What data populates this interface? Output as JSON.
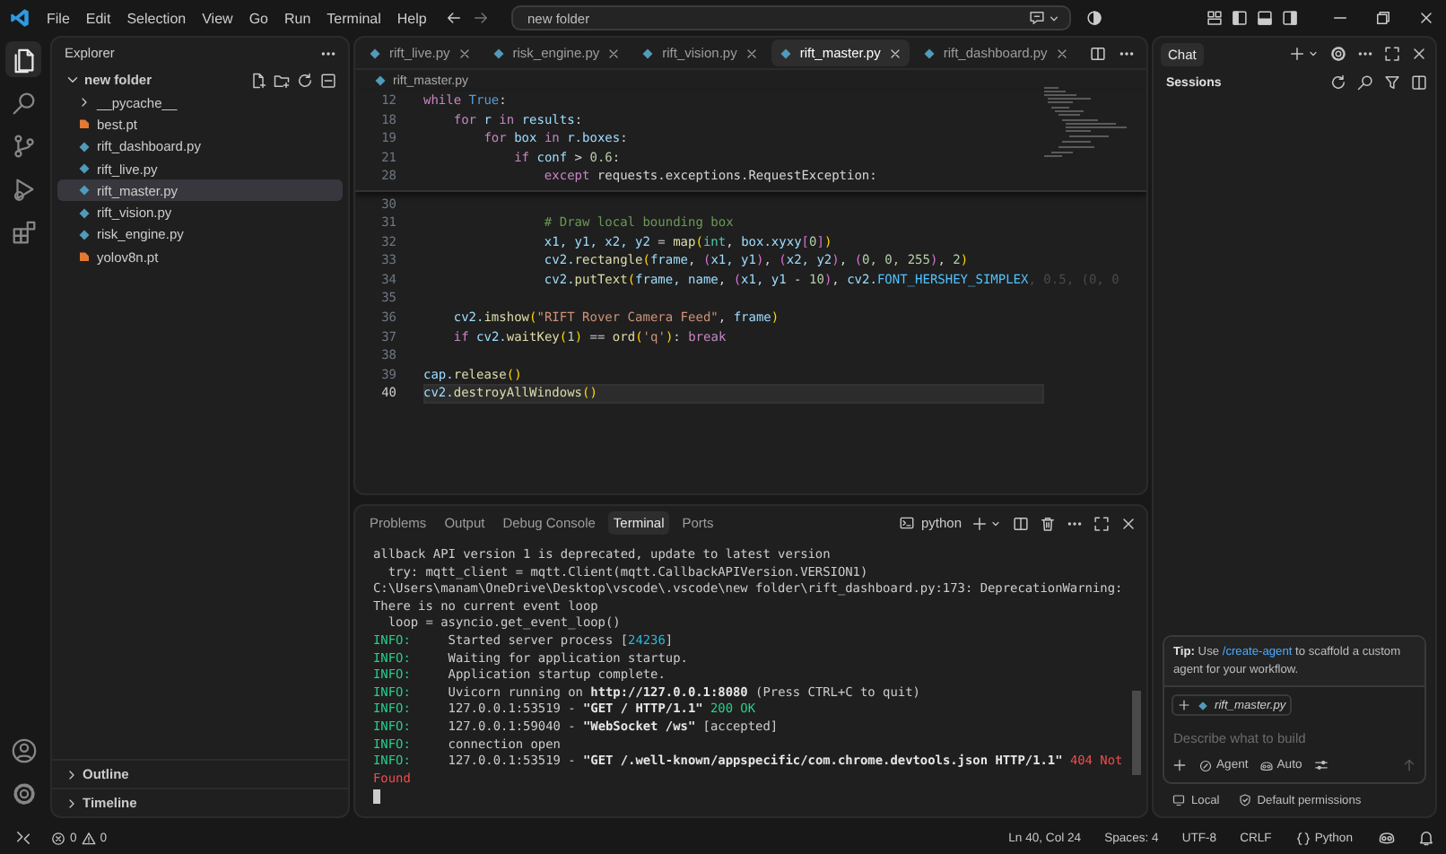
{
  "title_bar": {
    "menus": [
      "File",
      "Edit",
      "Selection",
      "View",
      "Go",
      "Run",
      "Terminal",
      "Help"
    ],
    "search": "new folder"
  },
  "activity_bar": [
    {
      "kind": "files",
      "selected": true
    },
    {
      "kind": "search",
      "selected": false
    },
    {
      "kind": "source-control",
      "selected": false
    },
    {
      "kind": "run",
      "selected": false
    },
    {
      "kind": "extensions",
      "selected": false
    }
  ],
  "explorer": {
    "title": "Explorer",
    "folder": {
      "name": "new folder",
      "expanded": true,
      "children": [
        {
          "name": "__pycache__",
          "kind": "folder",
          "expanded": false,
          "selected": false
        },
        {
          "name": "best.pt",
          "kind": "model",
          "selected": false
        },
        {
          "name": "rift_dashboard.py",
          "kind": "python",
          "selected": false
        },
        {
          "name": "rift_live.py",
          "kind": "python",
          "selected": false
        },
        {
          "name": "rift_master.py",
          "kind": "python",
          "selected": true
        },
        {
          "name": "rift_vision.py",
          "kind": "python",
          "selected": false
        },
        {
          "name": "risk_engine.py",
          "kind": "python",
          "selected": false
        },
        {
          "name": "yolov8n.pt",
          "kind": "model",
          "selected": false
        }
      ]
    },
    "sections": [
      {
        "name": "Outline",
        "expanded": false
      },
      {
        "name": "Timeline",
        "expanded": false
      }
    ]
  },
  "editor": {
    "tabs": [
      {
        "label": "rift_live.py",
        "selected": false
      },
      {
        "label": "risk_engine.py",
        "selected": false
      },
      {
        "label": "rift_vision.py",
        "selected": false
      },
      {
        "label": "rift_master.py",
        "selected": true
      },
      {
        "label": "rift_dashboard.py",
        "selected": false
      }
    ],
    "breadcrumb": "rift_master.py",
    "sticky_lines": [
      {
        "number": "12",
        "tokens": [
          {
            "text": "while",
            "kind": "kw"
          },
          {
            "text": " True",
            "kind": "const"
          },
          {
            "text": ":",
            "kind": "plain"
          }
        ]
      },
      {
        "number": "18",
        "tokens": [
          {
            "text": "    for",
            "kind": "kw"
          },
          {
            "text": " r ",
            "kind": "var"
          },
          {
            "text": "in",
            "kind": "kw"
          },
          {
            "text": " results",
            "kind": "var"
          },
          {
            "text": ":",
            "kind": "plain"
          }
        ]
      },
      {
        "number": "19",
        "tokens": [
          {
            "text": "        for",
            "kind": "kw"
          },
          {
            "text": " box ",
            "kind": "var"
          },
          {
            "text": "in",
            "kind": "kw"
          },
          {
            "text": " r.boxes",
            "kind": "var"
          },
          {
            "text": ":",
            "kind": "plain"
          }
        ]
      },
      {
        "number": "21",
        "tokens": [
          {
            "text": "            if",
            "kind": "kw"
          },
          {
            "text": " conf",
            "kind": "var"
          },
          {
            "text": " > ",
            "kind": "plain"
          },
          {
            "text": "0.6",
            "kind": "num"
          },
          {
            "text": ":",
            "kind": "plain"
          }
        ]
      },
      {
        "number": "28",
        "tokens": [
          {
            "text": "                except",
            "kind": "kw"
          },
          {
            "text": " requests.exceptions.RequestException:",
            "kind": "plain"
          }
        ]
      }
    ],
    "lines": [
      {
        "number": "30",
        "current": false
      },
      {
        "number": "31",
        "current": false,
        "tokens": [
          {
            "text": "                # Draw local bounding box",
            "kind": "com"
          }
        ]
      },
      {
        "number": "32",
        "current": false,
        "tokens": [
          {
            "text": "                x1, y1, x2, y2",
            "kind": "var"
          },
          {
            "text": " = ",
            "kind": "plain"
          },
          {
            "text": "map",
            "kind": "fn"
          },
          {
            "text": "(",
            "kind": "b1"
          },
          {
            "text": "int",
            "kind": "cls"
          },
          {
            "text": ", ",
            "kind": "plain"
          },
          {
            "text": "box.xyxy",
            "kind": "var"
          },
          {
            "text": "[",
            "kind": "b2"
          },
          {
            "text": "0",
            "kind": "num"
          },
          {
            "text": "]",
            "kind": "b2"
          },
          {
            "text": ")",
            "kind": "b1"
          }
        ]
      },
      {
        "number": "33",
        "current": false,
        "tokens": [
          {
            "text": "                cv2.",
            "kind": "var"
          },
          {
            "text": "rectangle",
            "kind": "fn"
          },
          {
            "text": "(",
            "kind": "b1"
          },
          {
            "text": "frame",
            "kind": "var"
          },
          {
            "text": ", ",
            "kind": "plain"
          },
          {
            "text": "(",
            "kind": "b2"
          },
          {
            "text": "x1, y1",
            "kind": "var"
          },
          {
            "text": ")",
            "kind": "b2"
          },
          {
            "text": ", ",
            "kind": "plain"
          },
          {
            "text": "(",
            "kind": "b2"
          },
          {
            "text": "x2, y2",
            "kind": "var"
          },
          {
            "text": ")",
            "kind": "b2"
          },
          {
            "text": ", ",
            "kind": "plain"
          },
          {
            "text": "(",
            "kind": "b2"
          },
          {
            "text": "0, 0, 255",
            "kind": "num"
          },
          {
            "text": ")",
            "kind": "b2"
          },
          {
            "text": ", ",
            "kind": "plain"
          },
          {
            "text": "2",
            "kind": "num"
          },
          {
            "text": ")",
            "kind": "b1"
          }
        ]
      },
      {
        "number": "34",
        "current": false,
        "tokens": [
          {
            "text": "                cv2.",
            "kind": "var"
          },
          {
            "text": "putText",
            "kind": "fn"
          },
          {
            "text": "(",
            "kind": "b1"
          },
          {
            "text": "frame, name",
            "kind": "var"
          },
          {
            "text": ", ",
            "kind": "plain"
          },
          {
            "text": "(",
            "kind": "b2"
          },
          {
            "text": "x1, y1",
            "kind": "var"
          },
          {
            "text": " - ",
            "kind": "plain"
          },
          {
            "text": "10",
            "kind": "num"
          },
          {
            "text": ")",
            "kind": "b2"
          },
          {
            "text": ", ",
            "kind": "plain"
          },
          {
            "text": "cv2.",
            "kind": "var"
          },
          {
            "text": "FONT_HERSHEY_SIMPLEX",
            "kind": "enum"
          },
          {
            "text": ", 0.5, (0, 0",
            "kind": "faded"
          }
        ]
      },
      {
        "number": "35",
        "current": false
      },
      {
        "number": "36",
        "current": false,
        "tokens": [
          {
            "text": "    cv2.",
            "kind": "var"
          },
          {
            "text": "imshow",
            "kind": "fn"
          },
          {
            "text": "(",
            "kind": "b1"
          },
          {
            "text": "\"RIFT Rover Camera Feed\"",
            "kind": "str"
          },
          {
            "text": ", ",
            "kind": "plain"
          },
          {
            "text": "frame",
            "kind": "var"
          },
          {
            "text": ")",
            "kind": "b1"
          }
        ]
      },
      {
        "number": "37",
        "current": false,
        "tokens": [
          {
            "text": "    if",
            "kind": "kw"
          },
          {
            "text": " cv2.",
            "kind": "var"
          },
          {
            "text": "waitKey",
            "kind": "fn"
          },
          {
            "text": "(",
            "kind": "b1"
          },
          {
            "text": "1",
            "kind": "num"
          },
          {
            "text": ")",
            "kind": "b1"
          },
          {
            "text": " == ",
            "kind": "plain"
          },
          {
            "text": "ord",
            "kind": "fn"
          },
          {
            "text": "(",
            "kind": "b1"
          },
          {
            "text": "'q'",
            "kind": "str"
          },
          {
            "text": ")",
            "kind": "b1"
          },
          {
            "text": ": ",
            "kind": "plain"
          },
          {
            "text": "break",
            "kind": "kw"
          }
        ]
      },
      {
        "number": "38",
        "current": false
      },
      {
        "number": "39",
        "current": false,
        "tokens": [
          {
            "text": "cap.",
            "kind": "var"
          },
          {
            "text": "release",
            "kind": "fn"
          },
          {
            "text": "()",
            "kind": "b1"
          }
        ]
      },
      {
        "number": "40",
        "current": true,
        "tokens": [
          {
            "text": "cv2.",
            "kind": "var"
          },
          {
            "text": "destroyAllWindows",
            "kind": "fn"
          },
          {
            "text": "()",
            "kind": "b1"
          }
        ]
      }
    ]
  },
  "panel": {
    "tabs": [
      {
        "label": "Problems",
        "selected": false
      },
      {
        "label": "Output",
        "selected": false
      },
      {
        "label": "Debug Console",
        "selected": false
      },
      {
        "label": "Terminal",
        "selected": true
      },
      {
        "label": "Ports",
        "selected": false
      }
    ],
    "shell": "python",
    "terminal_lines": [
      [
        {
          "text": "allback API version 1 is deprecated, update to latest version",
          "kind": "plain"
        }
      ],
      [
        {
          "text": "  try: mqtt_client = mqtt.Client(mqtt.CallbackAPIVersion.VERSION1)",
          "kind": "plain"
        }
      ],
      [
        {
          "text": "C:\\Users\\manam\\OneDrive\\Desktop\\vscode\\.vscode\\new folder\\rift_dashboard.py:173: DeprecationWarning:",
          "kind": "plain"
        }
      ],
      [
        {
          "text": "There is no current event loop",
          "kind": "plain"
        }
      ],
      [
        {
          "text": "  loop = asyncio.get_event_loop()",
          "kind": "plain"
        }
      ],
      [
        {
          "text": "INFO:",
          "kind": "info"
        },
        {
          "text": "     Started server process [",
          "kind": "plain"
        },
        {
          "text": "24236",
          "kind": "num"
        },
        {
          "text": "]",
          "kind": "plain"
        }
      ],
      [
        {
          "text": "INFO:",
          "kind": "info"
        },
        {
          "text": "     Waiting for application startup.",
          "kind": "plain"
        }
      ],
      [
        {
          "text": "INFO:",
          "kind": "info"
        },
        {
          "text": "     Application startup complete.",
          "kind": "plain"
        }
      ],
      [
        {
          "text": "INFO:",
          "kind": "info"
        },
        {
          "text": "     Uvicorn running on ",
          "kind": "plain"
        },
        {
          "text": "http://127.0.0.1:8080",
          "kind": "bold"
        },
        {
          "text": " (Press CTRL+C to quit)",
          "kind": "plain"
        }
      ],
      [
        {
          "text": "INFO:",
          "kind": "info"
        },
        {
          "text": "     127.0.0.1:53519 - ",
          "kind": "plain"
        },
        {
          "text": "\"GET / HTTP/1.1\"",
          "kind": "bold"
        },
        {
          "text": " 200 OK",
          "kind": "ok"
        }
      ],
      [
        {
          "text": "INFO:",
          "kind": "info"
        },
        {
          "text": "     127.0.0.1:59040 - ",
          "kind": "plain"
        },
        {
          "text": "\"WebSocket /ws\"",
          "kind": "bold"
        },
        {
          "text": " [accepted]",
          "kind": "plain"
        }
      ],
      [
        {
          "text": "INFO:",
          "kind": "info"
        },
        {
          "text": "     connection open",
          "kind": "plain"
        }
      ],
      [
        {
          "text": "INFO:",
          "kind": "info"
        },
        {
          "text": "     127.0.0.1:53519 - ",
          "kind": "plain"
        },
        {
          "text": "\"GET /.well-known/appspecific/com.chrome.devtools.json HTTP/1.1\"",
          "kind": "bold"
        },
        {
          "text": " 404 Not",
          "kind": "err"
        }
      ],
      [
        {
          "text": "Found",
          "kind": "err"
        }
      ]
    ]
  },
  "chat": {
    "title": "Chat",
    "sessions": "Sessions",
    "tip": {
      "before": "**Tip:** Use ",
      "link": "/create-agent",
      "after": " to scaffold a custom agent for your workflow."
    },
    "context_file": "rift_master.py",
    "placeholder": "Describe what to build",
    "mode": "Agent",
    "model": "Auto",
    "footer": [
      "Local",
      "Default permissions"
    ]
  },
  "status_bar": {
    "errors": "0",
    "warnings": "0",
    "items": [
      "Ln 40, Col 24",
      "Spaces: 4",
      "UTF-8",
      "CRLF"
    ],
    "language": "Python"
  }
}
